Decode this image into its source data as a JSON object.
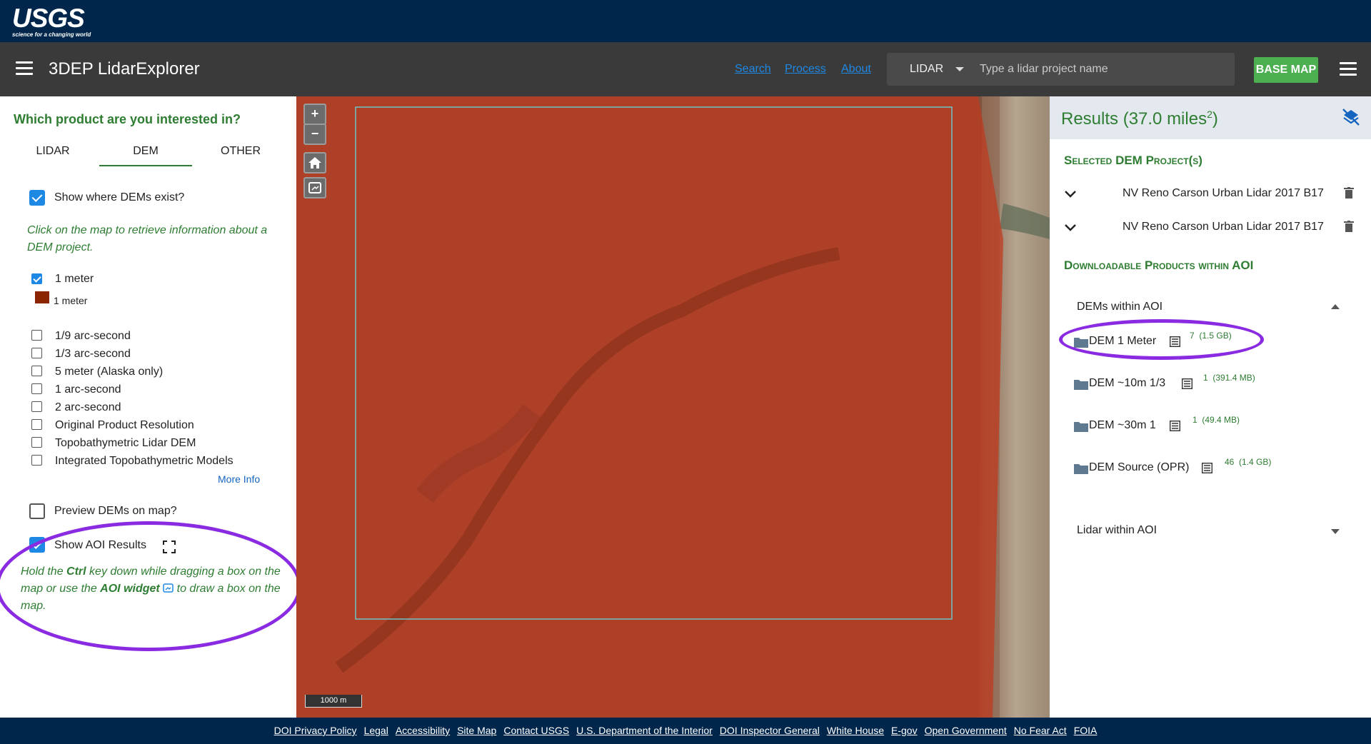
{
  "usgs": {
    "logo_text": "USGS",
    "tagline": "science for a changing world"
  },
  "app": {
    "title": "3DEP LidarExplorer"
  },
  "nav_links": [
    "Search",
    "Process",
    "About"
  ],
  "search": {
    "type_value": "LIDAR",
    "placeholder": "Type a lidar project name"
  },
  "basemap_label": "BASE MAP",
  "left_panel": {
    "question": "Which product are you interested in?",
    "tabs": [
      {
        "label": "LIDAR",
        "active": false
      },
      {
        "label": "DEM",
        "active": true
      },
      {
        "label": "OTHER",
        "active": false
      }
    ],
    "show_dems": {
      "label": "Show where DEMs exist?",
      "checked": true
    },
    "instruction": "Click on the map to retrieve information about a DEM project.",
    "one_meter": {
      "label": "1 meter",
      "checked": true
    },
    "legend_label": "1 meter",
    "legend_color": "#8b2500",
    "resolutions": [
      {
        "label": "1/9 arc-second",
        "checked": false
      },
      {
        "label": "1/3 arc-second",
        "checked": false
      },
      {
        "label": "5 meter (Alaska only)",
        "checked": false
      },
      {
        "label": "1 arc-second",
        "checked": false
      },
      {
        "label": "2 arc-second",
        "checked": false
      },
      {
        "label": "Original Product Resolution",
        "checked": false
      },
      {
        "label": "Topobathymetric Lidar DEM",
        "checked": false
      },
      {
        "label": "Integrated Topobathymetric Models",
        "checked": false
      }
    ],
    "more_info": "More Info",
    "preview": {
      "label": "Preview DEMs on map?",
      "checked": false
    },
    "aoi_results": {
      "label": "Show AOI Results",
      "checked": true
    },
    "aoi_help": {
      "p1": "Hold the ",
      "ctrl": "Ctrl",
      "p2": " key down while dragging a box on the map or use the ",
      "widget": "AOI widget",
      "p3": " to draw a box on the map."
    }
  },
  "map": {
    "scale_label": "1000 m",
    "zoom_in": "+",
    "zoom_out": "−"
  },
  "results": {
    "title": "Results (37.0 miles",
    "title_sup": "2",
    "title_end": ")",
    "selected_heading": "Selected DEM Project(s)",
    "projects": [
      "NV Reno Carson Urban Lidar 2017 B17",
      "NV Reno Carson Urban Lidar 2017 B17"
    ],
    "downloadable_heading": "Downloadable Products within AOI",
    "dems_heading": "DEMs within AOI",
    "products": [
      {
        "name": "DEM 1 Meter",
        "count": "7",
        "size": "(1.5 GB)"
      },
      {
        "name": "DEM ~10m 1/3",
        "count": "1",
        "size": "(391.4 MB)"
      },
      {
        "name": "DEM ~30m 1",
        "count": "1",
        "size": "(49.4 MB)"
      },
      {
        "name": "DEM Source (OPR)",
        "count": "46",
        "size": "(1.4 GB)"
      }
    ],
    "lidar_heading": "Lidar within AOI"
  },
  "footer_links": [
    "DOI Privacy Policy",
    "Legal",
    "Accessibility",
    "Site Map",
    "Contact USGS",
    "U.S. Department of the Interior",
    "DOI Inspector General",
    "White House",
    "E-gov",
    "Open Government",
    "No Fear Act",
    "FOIA"
  ],
  "colors": {
    "header": "#00264c",
    "appbar": "#3a3a3a",
    "accent_green": "#2e7d32",
    "overlay": "#c0391f",
    "annotation": "#8a2be2"
  }
}
